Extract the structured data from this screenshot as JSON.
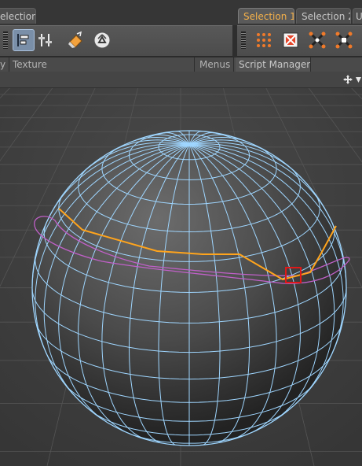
{
  "tabs": [
    {
      "label": "election"
    },
    {
      "label": "Selection 1"
    },
    {
      "label": "Selection 2"
    },
    {
      "label": "U"
    }
  ],
  "menubar": {
    "left_item": "y",
    "texture": "Texture",
    "menus": "Menus",
    "script_manager": "Script Manager"
  },
  "colors": {
    "active_tab_text": "#f5b14a",
    "wireframe": "#9fd6ff",
    "selection_edge": "#ffa41c",
    "magenta_outline": "#c060c8",
    "red_marker": "#e01818"
  },
  "icons": [
    "grip-icon",
    "align-left-icon",
    "grid-columns-icon",
    "paint-bucket-icon",
    "recycle-icon",
    "dots-grid-icon",
    "x-box-icon",
    "scale-points-icon",
    "scale-points-alt-icon",
    "move-arrows-icon",
    "dropdown-arrow-icon"
  ]
}
